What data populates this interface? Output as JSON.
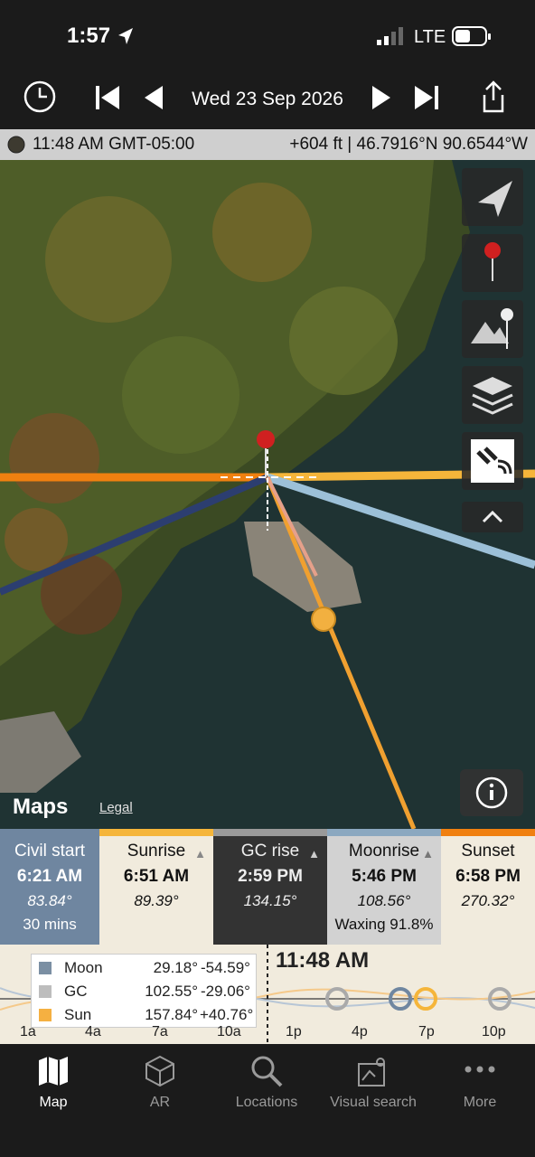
{
  "status_bar": {
    "time": "1:57",
    "network": "LTE"
  },
  "toolbar": {
    "date": "Wed 23 Sep 2026"
  },
  "info_strip": {
    "time": "11:48 AM GMT-05:00",
    "coords": "+604 ft | 46.7916°N 90.6544°W"
  },
  "map": {
    "maps_brand": "Maps",
    "legal_label": "Legal"
  },
  "events": [
    {
      "name": "Civil start",
      "time": "6:21 AM",
      "angle": "83.84°",
      "extra": "30 mins",
      "arrow": ""
    },
    {
      "name": "Sunrise",
      "time": "6:51 AM",
      "angle": "89.39°",
      "extra": "",
      "arrow": "▲"
    },
    {
      "name": "GC rise",
      "time": "2:59 PM",
      "angle": "134.15°",
      "extra": "",
      "arrow": "▲"
    },
    {
      "name": "Moonrise",
      "time": "5:46 PM",
      "angle": "108.56°",
      "extra": "Waxing 91.8%",
      "arrow": "▲"
    },
    {
      "name": "Sunset",
      "time": "6:58 PM",
      "angle": "270.32°",
      "extra": "",
      "arrow": ""
    }
  ],
  "timeline": {
    "current_time": "11:48 AM",
    "legend": [
      {
        "name": "Moon",
        "azimuth": "29.18°",
        "elevation": "-54.59°",
        "color": "#7b8fa3"
      },
      {
        "name": "GC",
        "azimuth": "102.55°",
        "elevation": "-29.06°",
        "color": "#bdbdbd"
      },
      {
        "name": "Sun",
        "azimuth": "157.84°",
        "elevation": "+40.76°",
        "color": "#f5b041"
      }
    ],
    "ticks": [
      "1a",
      "4a",
      "7a",
      "10a",
      "1p",
      "4p",
      "7p",
      "10p"
    ]
  },
  "tabs": [
    {
      "label": "Map",
      "icon": "map-icon",
      "active": true
    },
    {
      "label": "AR",
      "icon": "ar-cube-icon",
      "active": false
    },
    {
      "label": "Locations",
      "icon": "search-icon",
      "active": false
    },
    {
      "label": "Visual search",
      "icon": "visual-search-icon",
      "active": false
    },
    {
      "label": "More",
      "icon": "more-icon",
      "active": false
    }
  ],
  "colors": {
    "sun_line": "#f0a030",
    "sunrise_line": "#f08010",
    "moon_line": "#9cc0d8",
    "dark_line": "#2c3e70"
  }
}
